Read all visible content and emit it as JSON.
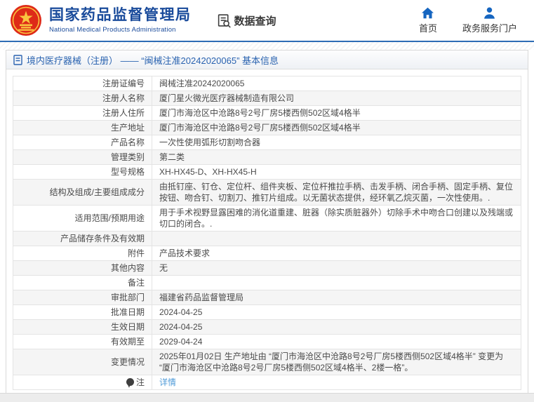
{
  "header": {
    "org_name_cn": "国家药品监督管理局",
    "org_name_en": "National Medical Products Administration",
    "data_query_label": "数据查询",
    "nav": [
      {
        "label": "首页",
        "icon": "home-icon"
      },
      {
        "label": "政务服务门户",
        "icon": "person-icon"
      }
    ]
  },
  "breadcrumb": {
    "text": "境内医疗器械（注册） —— “闽械注准20242020065” 基本信息"
  },
  "table": {
    "rows": [
      {
        "label": "注册证编号",
        "value": "闽械注准20242020065"
      },
      {
        "label": "注册人名称",
        "value": "厦门星火微光医疗器械制造有限公司"
      },
      {
        "label": "注册人住所",
        "value": "厦门市海沧区中沧路8号2号厂房5楼西侧502区域4格半"
      },
      {
        "label": "生产地址",
        "value": "厦门市海沧区中沧路8号2号厂房5楼西侧502区域4格半"
      },
      {
        "label": "产品名称",
        "value": "一次性使用弧形切割吻合器"
      },
      {
        "label": "管理类别",
        "value": "第二类"
      },
      {
        "label": "型号规格",
        "value": "XH-HX45-D、XH-HX45-H"
      },
      {
        "label": "结构及组成/主要组成成分",
        "value": "由抵钉座、钉仓、定位杆、组件夹板、定位杆推拉手柄、击发手柄、闭合手柄、固定手柄、复位按钮、吻合钉、切割刀、推钉片组成。以无菌状态提供，经环氧乙烷灭菌，一次性使用。."
      },
      {
        "label": "适用范围/预期用途",
        "value": "用于手术视野显露困难的消化道重建、脏器（除实质脏器外）切除手术中吻合口创建以及残端或切口的闭合。."
      },
      {
        "label": "产品储存条件及有效期",
        "value": ""
      },
      {
        "label": "附件",
        "value": "产品技术要求"
      },
      {
        "label": "其他内容",
        "value": "无"
      },
      {
        "label": "备注",
        "value": ""
      },
      {
        "label": "审批部门",
        "value": "福建省药品监督管理局"
      },
      {
        "label": "批准日期",
        "value": "2024-04-25"
      },
      {
        "label": "生效日期",
        "value": "2024-04-25"
      },
      {
        "label": "有效期至",
        "value": "2029-04-24"
      },
      {
        "label": "变更情况",
        "value": "2025年01月02日 生产地址由 “厦门市海沧区中沧路8号2号厂房5楼西侧502区域4格半” 变更为 “厦门市海沧区中沧路8号2号厂房5楼西侧502区域4格半、2楼一格”。"
      },
      {
        "label": "注",
        "value": "详情",
        "link": true,
        "icon": "note-icon"
      }
    ]
  },
  "colors": {
    "brand_blue": "#1a4b9b",
    "header_rule_blue": "#2e6cb5",
    "nav_icon_blue": "#1565c0",
    "breadcrumb_blue": "#2a63b0",
    "link_blue": "#4f9bd8",
    "row_alt_gray": "#f5f5f5",
    "emblem_red": "#de2a18",
    "emblem_gold": "#f9c43f"
  }
}
